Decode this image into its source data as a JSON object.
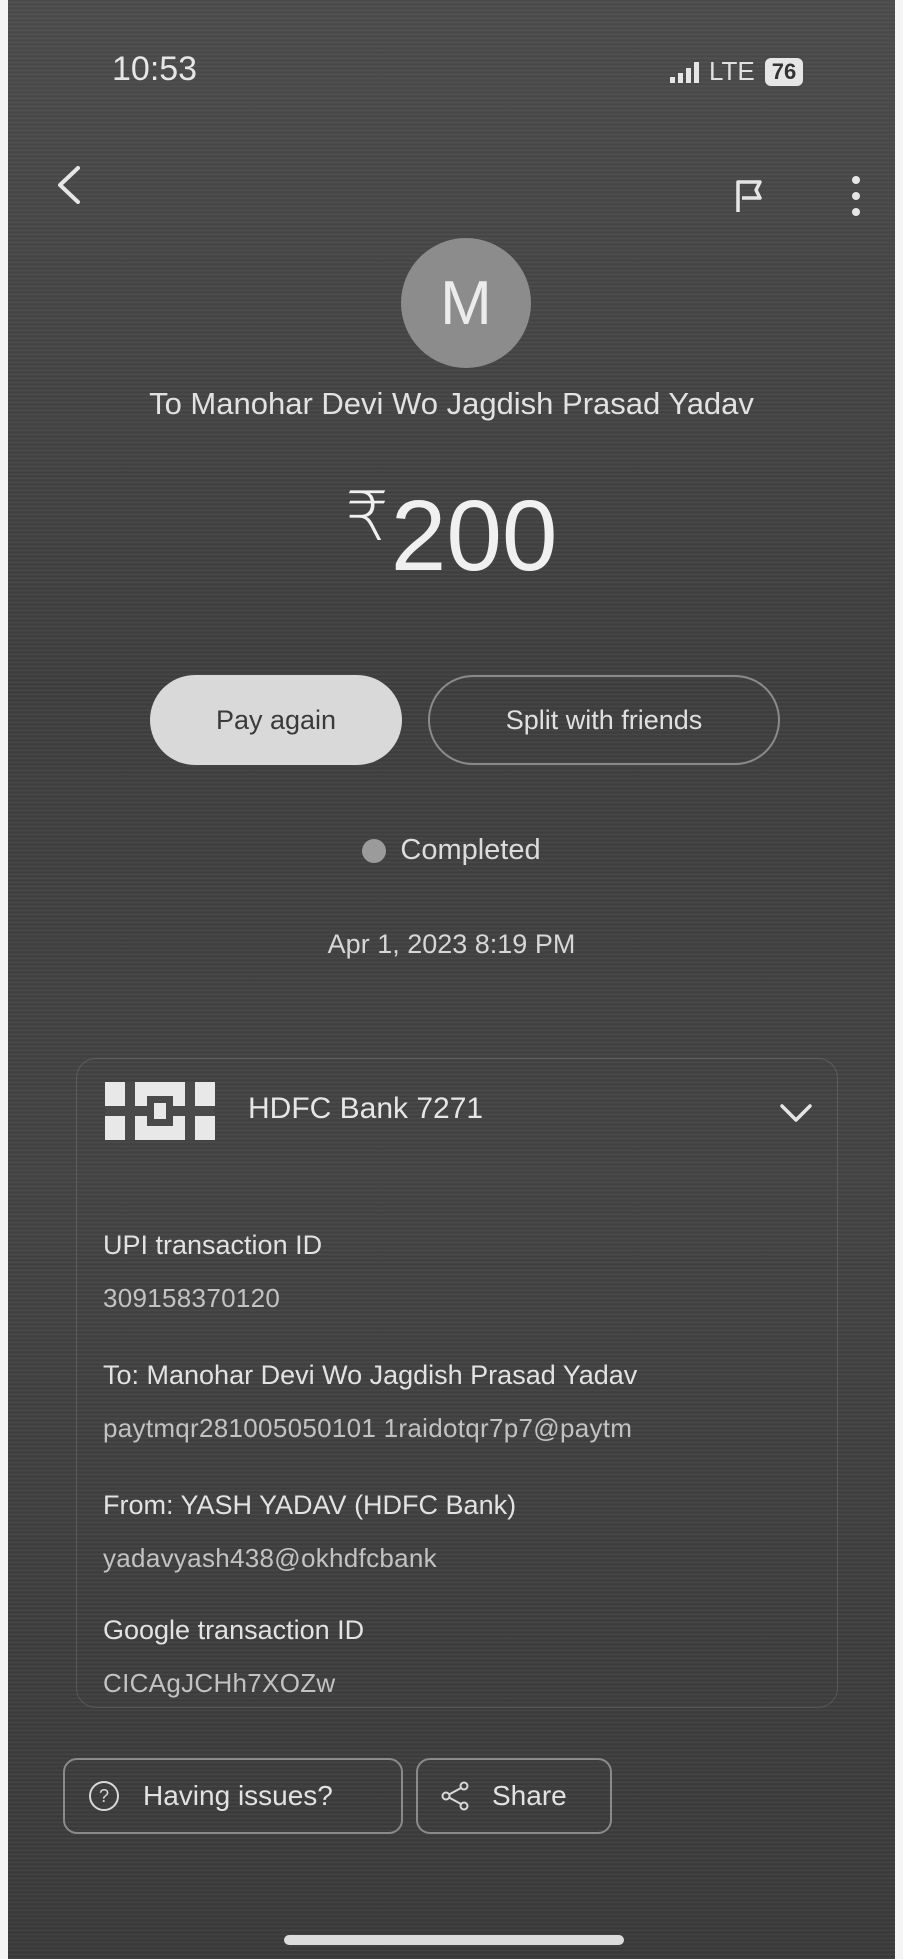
{
  "status_bar": {
    "time": "10:53",
    "network": "LTE",
    "battery": "76"
  },
  "header": {
    "back_icon": "back-arrow-icon",
    "flag_icon": "flag-icon",
    "more_icon": "more-vert-icon"
  },
  "payee": {
    "avatar_letter": "M",
    "title": "To Manohar Devi Wo Jagdish Prasad Yadav"
  },
  "payment": {
    "currency_symbol": "₹",
    "amount": "200",
    "pay_again_label": "Pay again",
    "split_label": "Split with friends",
    "status": "Completed",
    "datetime": "Apr 1, 2023 8:19 PM"
  },
  "details": {
    "bank_name": "HDFC Bank 7271",
    "upi_label": "UPI transaction ID",
    "upi_value": "309158370120",
    "to_label": "To: Manohar Devi Wo Jagdish Prasad Yadav",
    "to_value": "paytmqr281005050101 1raidotqr7p7@paytm",
    "from_label": "From: YASH YADAV (HDFC Bank)",
    "from_value": "yadavyash438@okhdfcbank",
    "google_label": "Google transaction ID",
    "google_value": "CICAgJCHh7XOZw"
  },
  "actions": {
    "help_label": "Having issues?",
    "share_label": "Share"
  }
}
